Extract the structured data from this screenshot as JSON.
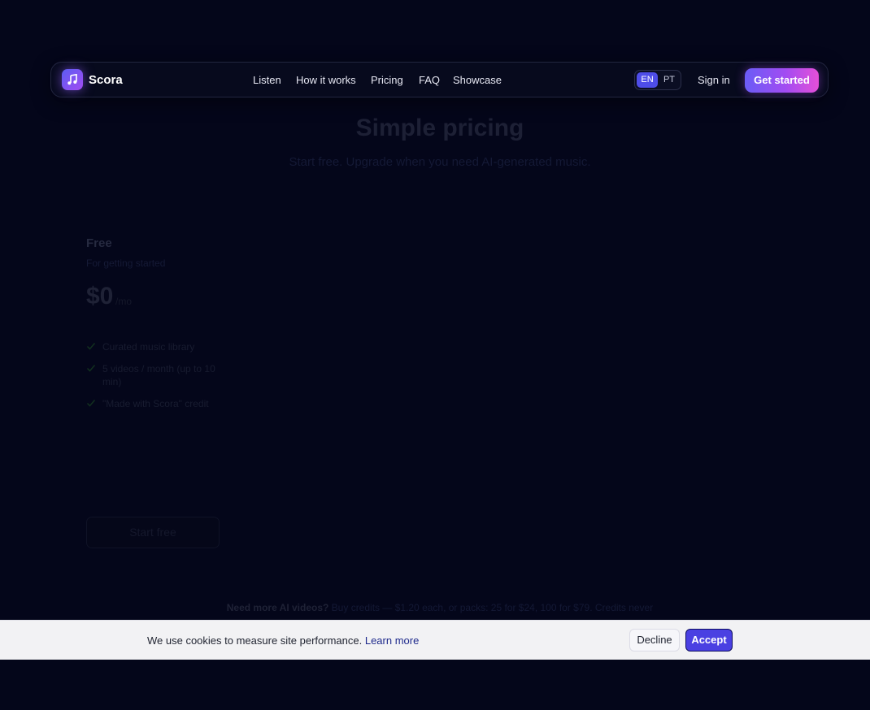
{
  "nav": {
    "brand": "Scora",
    "brand_icon": "music-note-icon",
    "links": [
      "Listen",
      "How it works",
      "Pricing",
      "FAQ",
      "Showcase"
    ],
    "languages": [
      "EN",
      "PT"
    ],
    "active_language": "EN",
    "sign_in": "Sign in",
    "get_started": "Get started"
  },
  "hero": {
    "title": "Simple pricing",
    "subtitle": "Start free. Upgrade when you need AI-generated music."
  },
  "plan": {
    "name": "Free",
    "tagline": "For getting started",
    "price": "$0",
    "period": "/mo",
    "features": [
      "Curated music library",
      "5 videos / month (up to 10 min)",
      "\"Made with Scora\" credit"
    ],
    "cta": "Start free"
  },
  "credits_note": {
    "lead": "Need more AI videos?",
    "text": " Buy credits — $1.20 each, or packs: 25 for $24, 100 for $79. Credits never"
  },
  "cookie_banner": {
    "message": "We use cookies to measure site performance.",
    "link": "Learn more",
    "decline": "Decline",
    "accept": "Accept"
  },
  "colors": {
    "background": "#04061a",
    "accent": "#4a40e2",
    "gradient_start": "#6a5cf6",
    "gradient_end": "#e54fd8",
    "banner": "#f2f2f4"
  }
}
